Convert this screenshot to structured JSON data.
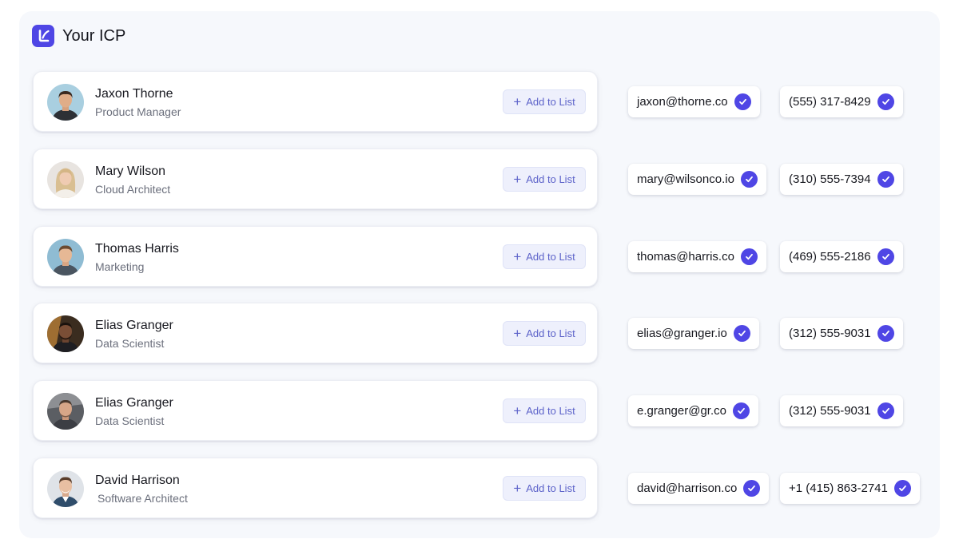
{
  "app": {
    "title": "Your ICP",
    "logo_icon": "brand-logo-icon"
  },
  "colors": {
    "accent": "#4f46e5",
    "button_bg": "#eef0fc",
    "button_text": "#5c62c9",
    "panel_bg": "#f6f8fc"
  },
  "add_button_label": "Add to List",
  "contacts": [
    {
      "name": "Jaxon Thorne",
      "role": "Product Manager",
      "email": "jaxon@thorne.co",
      "phone": "(555) 317-8429"
    },
    {
      "name": "Mary Wilson",
      "role": "Cloud Architect",
      "email": "mary@wilsonco.io",
      "phone": "(310) 555-7394"
    },
    {
      "name": "Thomas Harris",
      "role": "Marketing",
      "email": "thomas@harris.co",
      "phone": "(469) 555-2186"
    },
    {
      "name": "Elias Granger",
      "role": "Data Scientist",
      "email": "elias@granger.io",
      "phone": "(312) 555-9031"
    },
    {
      "name": "Elias Granger",
      "role": "Data Scientist",
      "email": "e.granger@gr.co",
      "phone": "(312) 555-9031"
    },
    {
      "name": "David Harrison",
      "role": "Software Architect",
      "email": "david@harrison.co",
      "phone": "+1 (415) 863-2741"
    }
  ]
}
